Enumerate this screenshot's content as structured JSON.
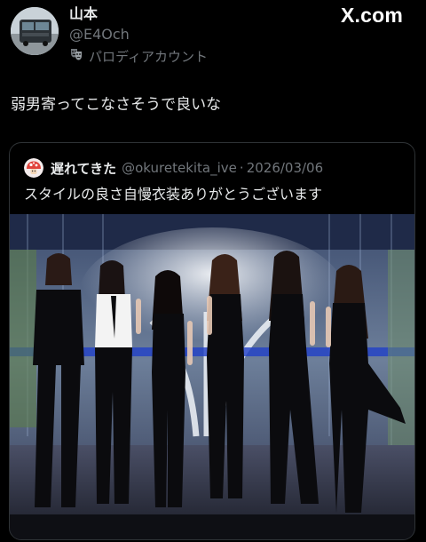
{
  "brand": {
    "watermark": "X.com"
  },
  "author": {
    "display_name": "山本",
    "handle": "@E4Och",
    "parody_label": "パロディアカウント",
    "avatar_icon": "avatar-photo",
    "parody_icon": "theater-masks-icon"
  },
  "tweet": {
    "text": "弱男寄ってこなさそうで良いな"
  },
  "quoted": {
    "display_name": "遅れてきた",
    "handle": "@okuretekita_ive",
    "separator": "·",
    "date": "2026/03/06",
    "text": "スタイルの良さ自慢衣装ありがとうございます",
    "avatar_icon": "mushroom-avatar-icon"
  },
  "colors": {
    "background": "#000000",
    "primary_text": "#e7e9ea",
    "secondary_text": "#71767b",
    "border": "#2f3336"
  }
}
